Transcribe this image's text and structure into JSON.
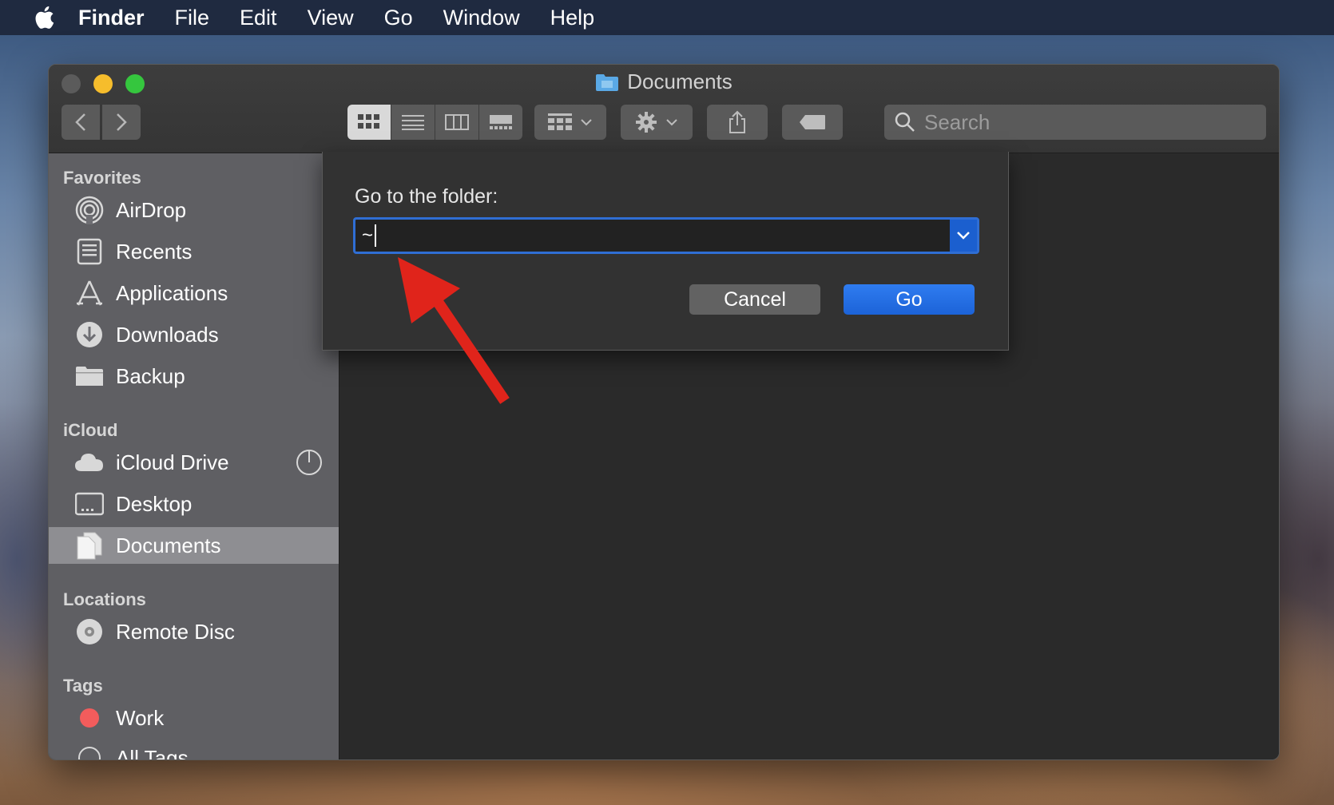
{
  "menubar": {
    "apple_icon": "apple-logo-icon",
    "items": [
      "Finder",
      "File",
      "Edit",
      "View",
      "Go",
      "Window",
      "Help"
    ]
  },
  "window": {
    "title": "Documents",
    "search_placeholder": "Search"
  },
  "sidebar": {
    "favorites_heading": "Favorites",
    "favorites": [
      {
        "label": "AirDrop",
        "icon": "airdrop-icon"
      },
      {
        "label": "Recents",
        "icon": "recents-icon"
      },
      {
        "label": "Applications",
        "icon": "applications-icon"
      },
      {
        "label": "Downloads",
        "icon": "downloads-icon"
      },
      {
        "label": "Backup",
        "icon": "folder-icon"
      }
    ],
    "icloud_heading": "iCloud",
    "icloud": [
      {
        "label": "iCloud Drive",
        "icon": "cloud-icon"
      },
      {
        "label": "Desktop",
        "icon": "desktop-icon"
      },
      {
        "label": "Documents",
        "icon": "documents-icon",
        "selected": true
      }
    ],
    "locations_heading": "Locations",
    "locations": [
      {
        "label": "Remote Disc",
        "icon": "disc-icon"
      }
    ],
    "tags_heading": "Tags",
    "tags": [
      {
        "label": "Work",
        "color": "#f25c5c"
      },
      {
        "label": "All Tags…"
      }
    ]
  },
  "sheet": {
    "label": "Go to the folder:",
    "field_value": "~",
    "cancel_label": "Cancel",
    "go_label": "Go"
  },
  "colors": {
    "accent": "#1c63d8",
    "arrow": "#e0241b"
  }
}
